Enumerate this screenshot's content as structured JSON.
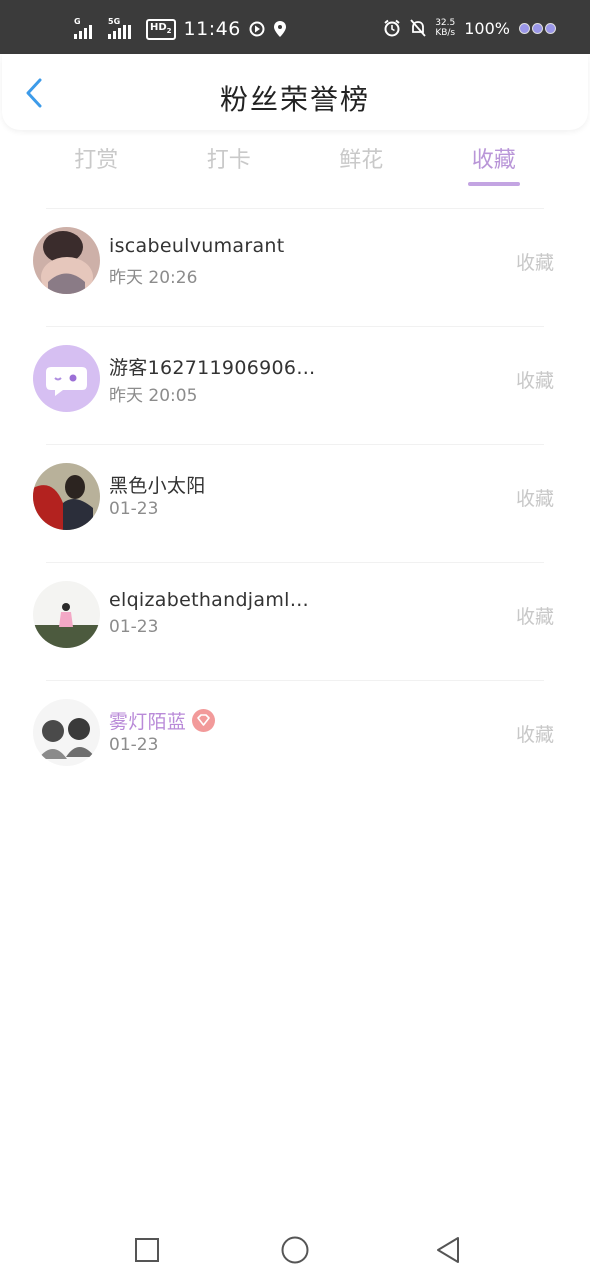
{
  "status_bar": {
    "signal1_label": "G",
    "signal2_label": "5G",
    "hd_label": "HD",
    "hd_sub": "2",
    "time": "11:46",
    "speed_value": "32.5",
    "speed_unit": "KB/s",
    "battery": "100%"
  },
  "header": {
    "title": "粉丝荣誉榜"
  },
  "tabs": [
    {
      "label": "打赏",
      "active": false
    },
    {
      "label": "打卡",
      "active": false
    },
    {
      "label": "鲜花",
      "active": false
    },
    {
      "label": "收藏",
      "active": true
    }
  ],
  "list": [
    {
      "name": "iscabeulvumarant",
      "time": "昨天 20:26",
      "action": "收藏"
    },
    {
      "name": "游客162711906906…",
      "time": "昨天 20:05",
      "action": "收藏"
    },
    {
      "name": "黑色小太阳",
      "time": "01-23",
      "action": "收藏"
    },
    {
      "name": "elqizabethandjaml…",
      "time": "01-23",
      "action": "收藏"
    },
    {
      "name": "雾灯陌蓝",
      "time": "01-23",
      "action": "收藏",
      "vip": true
    }
  ],
  "colors": {
    "accent": "#b996d8",
    "status_bar_bg": "#3b3b3b",
    "back_icon": "#3d9be9",
    "vip_badge": "#f29a9a"
  },
  "icons": {
    "back": "chevron-left-icon",
    "nav_recent": "square-icon",
    "nav_home": "circle-icon",
    "nav_back": "triangle-left-icon"
  }
}
